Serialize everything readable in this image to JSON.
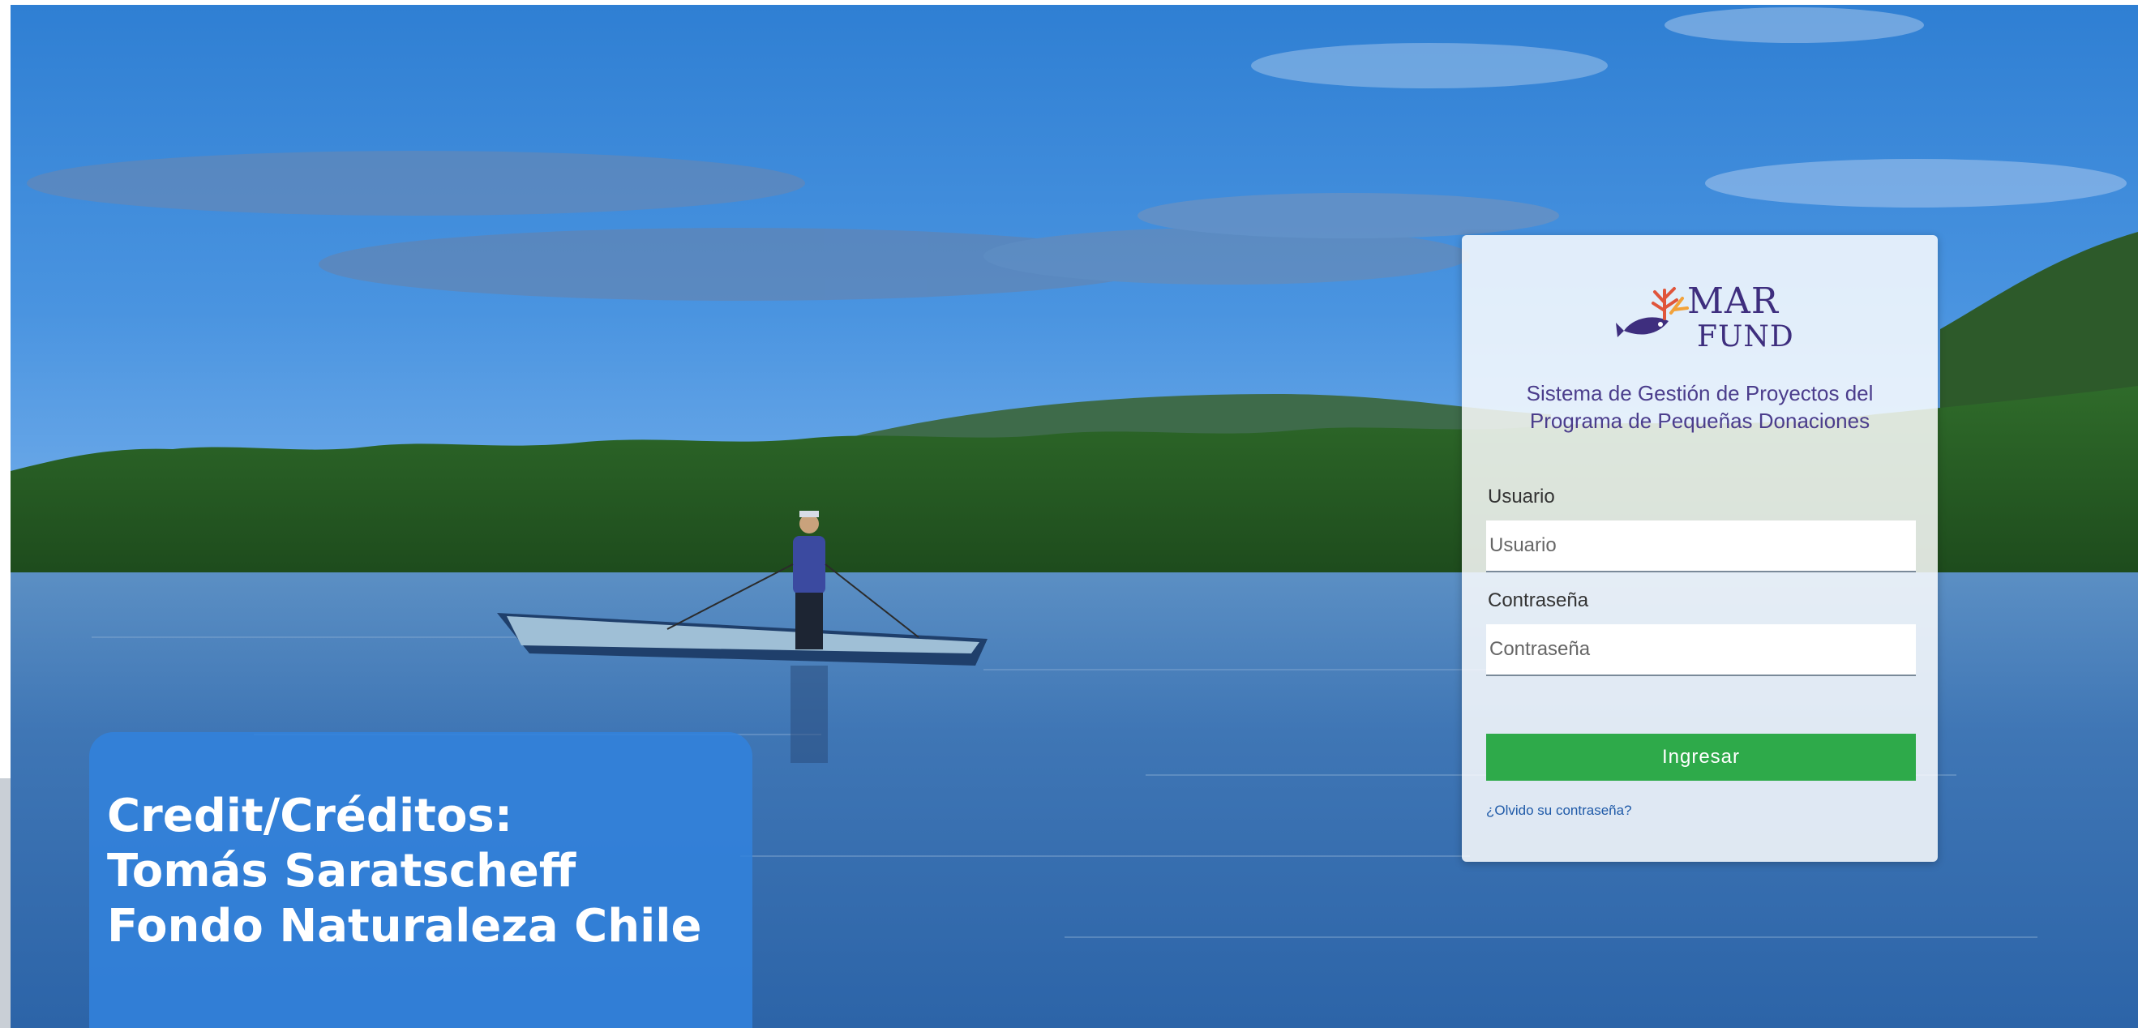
{
  "credit": {
    "line1": "Credit/Créditos:",
    "line2": "Tomás Saratscheff",
    "line3": "Fondo Naturaleza Chile"
  },
  "login": {
    "logo": {
      "text_top": "MAR",
      "text_bottom": "FUND"
    },
    "subtitle_line1": "Sistema de Gestión de Proyectos del",
    "subtitle_line2": "Programa de Pequeñas Donaciones",
    "username": {
      "label": "Usuario",
      "placeholder": "Usuario",
      "value": ""
    },
    "password": {
      "label": "Contraseña",
      "placeholder": "Contraseña",
      "value": ""
    },
    "submit_label": "Ingresar",
    "forgot_label": "¿Olvido su contraseña?"
  },
  "colors": {
    "accent_green": "#2eaa4a",
    "brand_purple": "#3e2e7e",
    "link_blue": "#1f5aa8",
    "credit_blue": "#3282dc"
  }
}
